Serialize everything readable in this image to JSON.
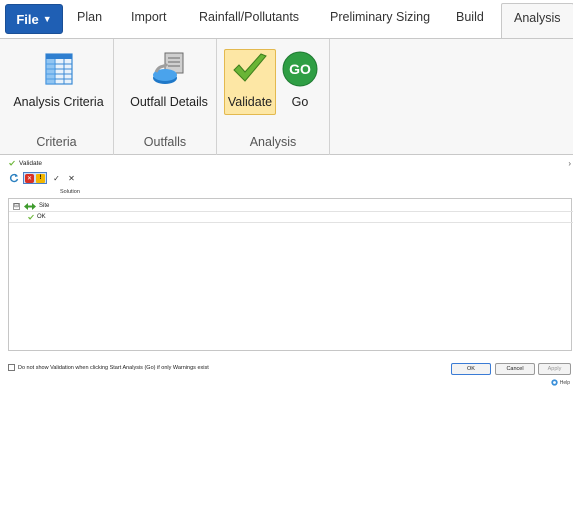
{
  "tabs": {
    "file": "File",
    "items": [
      "Plan",
      "Import",
      "Rainfall/Pollutants",
      "Preliminary Sizing",
      "Build",
      "Analysis"
    ],
    "active": "Analysis"
  },
  "ribbon": {
    "groups": [
      {
        "label": "Criteria",
        "buttons": [
          {
            "label": "Analysis Criteria",
            "icon": "table-grid-icon"
          }
        ]
      },
      {
        "label": "Outfalls",
        "buttons": [
          {
            "label": "Outfall Details",
            "icon": "outfall-pipe-icon"
          }
        ]
      },
      {
        "label": "Analysis",
        "buttons": [
          {
            "label": "Validate",
            "icon": "checkmark-icon",
            "pressed": true
          },
          {
            "label": "Go",
            "icon": "go-icon",
            "icon_text": "GO"
          }
        ]
      }
    ]
  },
  "pane": {
    "title": "Validate",
    "column_header": "Solution",
    "tree": [
      {
        "label": "Site",
        "level": 0,
        "icon": "site-icon",
        "expander": "⊟"
      },
      {
        "label": "OK",
        "level": 1,
        "icon": "checkmark-icon"
      }
    ],
    "toolbar": {
      "x_mark": "✕",
      "check_mark": "✓",
      "warning_mark": "!"
    },
    "checkbox_label": "Do not show Validation when clicking Start Analysis (Go) if only Warnings exist",
    "buttons": {
      "ok": "OK",
      "cancel": "Cancel",
      "apply": "Apply"
    },
    "help": "Help"
  },
  "colors": {
    "file_button": "#1f5fb4",
    "pressed": "#fde7a5",
    "check_green": "#5aa72c",
    "go_green": "#2f9e44"
  }
}
